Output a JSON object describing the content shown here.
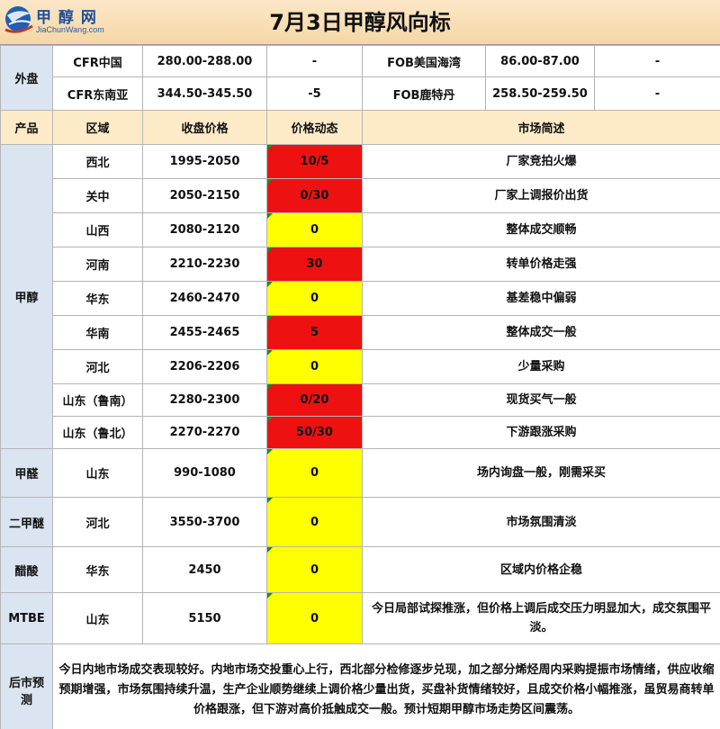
{
  "header": {
    "title": "7月3日甲醇风向标",
    "logo_name": "甲 醇 网",
    "logo_url": "JiaChunWang.com"
  },
  "external": {
    "label": "外盘",
    "rows": [
      {
        "market_a": "CFR中国",
        "price_a": "280.00-288.00",
        "change_a": "-",
        "market_b": "FOB美国海湾",
        "price_b": "86.00-87.00",
        "change_b": "-"
      },
      {
        "market_a": "CFR东南亚",
        "price_a": "344.50-345.50",
        "change_a": "-5",
        "market_b": "FOB鹿特丹",
        "price_b": "258.50-259.50",
        "change_b": "-"
      }
    ]
  },
  "columns": {
    "product": "产品",
    "region": "区域",
    "close_price": "收盘价格",
    "price_change": "价格动态",
    "market_summary": "市场简述"
  },
  "methanol": {
    "label": "甲醇",
    "rows": [
      {
        "region": "西北",
        "price": "1995-2050",
        "change": "10/5",
        "status": "red",
        "summary": "厂家竞拍火爆"
      },
      {
        "region": "关中",
        "price": "2050-2150",
        "change": "0/30",
        "status": "red",
        "summary": "厂家上调报价出货"
      },
      {
        "region": "山西",
        "price": "2080-2120",
        "change": "0",
        "status": "yellow",
        "summary": "整体成交顺畅"
      },
      {
        "region": "河南",
        "price": "2210-2230",
        "change": "30",
        "status": "red",
        "summary": "转单价格走强"
      },
      {
        "region": "华东",
        "price": "2460-2470",
        "change": "0",
        "status": "yellow",
        "summary": "基差稳中偏弱"
      },
      {
        "region": "华南",
        "price": "2455-2465",
        "change": "5",
        "status": "red",
        "summary": "整体成交一般"
      },
      {
        "region": "河北",
        "price": "2206-2206",
        "change": "0",
        "status": "yellow",
        "summary": "少量采购"
      },
      {
        "region": "山东（鲁南）",
        "price": "2280-2300",
        "change": "0/20",
        "status": "red",
        "summary": "现货买气一般"
      },
      {
        "region": "山东（鲁北）",
        "price": "2270-2270",
        "change": "50/30",
        "status": "red",
        "summary": "下游跟涨采购"
      }
    ]
  },
  "downstream": [
    {
      "product": "甲醛",
      "region": "山东",
      "price": "990-1080",
      "change": "0",
      "status": "yellow",
      "summary": "场内询盘一般，刚需采买"
    },
    {
      "product": "二甲醚",
      "region": "河北",
      "price": "3550-3700",
      "change": "0",
      "status": "yellow",
      "summary": "市场氛围清淡"
    },
    {
      "product": "醋酸",
      "region": "华东",
      "price": "2450",
      "change": "0",
      "status": "yellow",
      "summary": "区域内价格企稳"
    },
    {
      "product": "MTBE",
      "region": "山东",
      "price": "5150",
      "change": "0",
      "status": "yellow",
      "summary": "今日局部试探推涨，但价格上调后成交压力明显加大，成交氛围平淡。"
    }
  ],
  "forecast": {
    "label": "后市预测",
    "text": "今日内地市场成交表现较好。内地市场交投重心上行，西北部分检修逐步兑现，加之部分烯烃周内采购提振市场情绪，供应收缩预期增强，市场氛围持续升温，生产企业顺势继续上调价格少量出货，买盘补货情绪较好，且成交价格小幅推涨，虽贸易商转单价格跟涨，但下游对高价抵触成交一般。预计短期甲醇市场走势区间震荡。"
  },
  "colors": {
    "up": "#ee1111",
    "flat": "#ffff00",
    "side_bg": "#dbe5f1",
    "header_bg": "#fdebc8"
  }
}
